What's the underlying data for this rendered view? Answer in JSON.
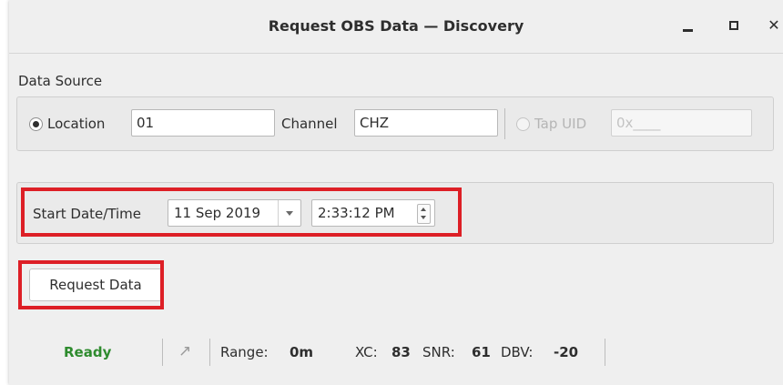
{
  "window": {
    "title": "Request OBS Data — Discovery",
    "controls": {
      "minimize": "_",
      "maximize": "□",
      "close": "✕"
    }
  },
  "data_source": {
    "label": "Data Source",
    "location": {
      "label": "Location",
      "selected": true,
      "value": "01"
    },
    "channel": {
      "label": "Channel",
      "value": "CHZ"
    },
    "tap_uid": {
      "label": "Tap UID",
      "selected": false,
      "enabled": false,
      "value": "0x____"
    }
  },
  "start": {
    "label": "Start Date/Time",
    "date": "11 Sep 2019",
    "time": "2:33:12 PM"
  },
  "request_button": {
    "label": "Request Data"
  },
  "status": {
    "state": "Ready",
    "state_color": "#2e8b2e",
    "icon": "arrow-up-right-icon",
    "range_label": "Range:",
    "range_value": "0m",
    "xc_label": "XC:",
    "xc_value": "83",
    "snr_label": "SNR:",
    "snr_value": "61",
    "dbv_label": "DBV:",
    "dbv_value": "-20"
  },
  "highlight_color": "#dd1f26"
}
